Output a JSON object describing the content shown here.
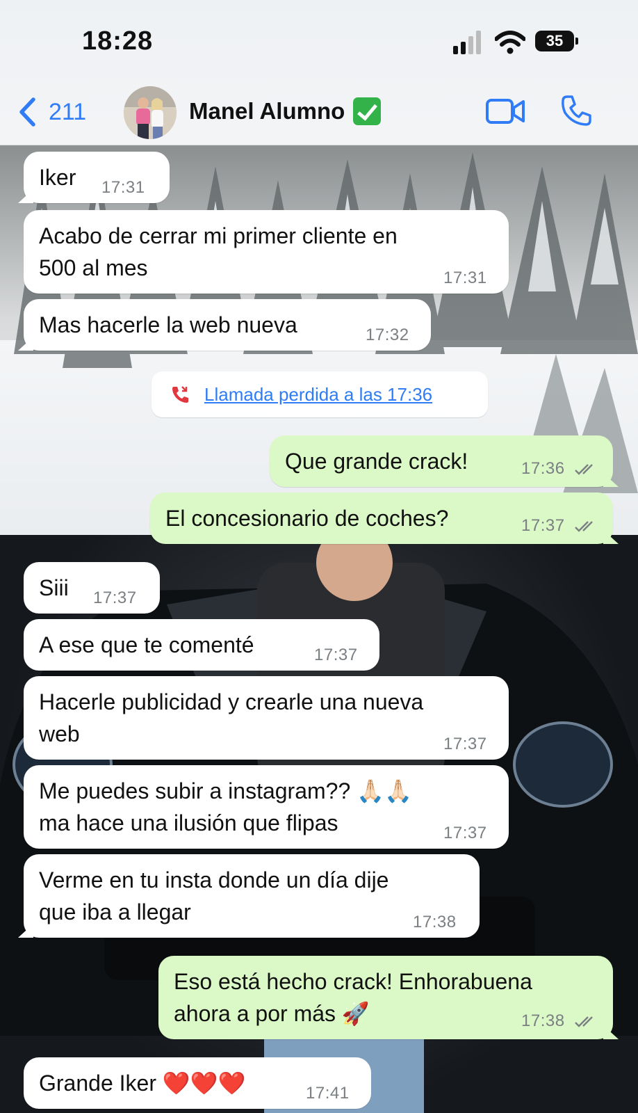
{
  "status_bar": {
    "time": "18:28",
    "battery": "35"
  },
  "header": {
    "back_count": "211",
    "contact_name": "Manel Alumno"
  },
  "messages": [
    {
      "text": "Iker",
      "time": "17:31"
    },
    {
      "text": "Acabo de cerrar mi primer cliente en\n500 al mes",
      "time": "17:31"
    },
    {
      "text": "Mas hacerle la web nueva",
      "time": "17:32"
    },
    {
      "text": "Llamada perdida a las 17:36"
    },
    {
      "text": "Que grande crack!",
      "time": "17:36"
    },
    {
      "text": "El concesionario de coches?",
      "time": "17:37"
    },
    {
      "text": "Siii",
      "time": "17:37"
    },
    {
      "text": "A ese que te comenté",
      "time": "17:37"
    },
    {
      "text": "Hacerle publicidad y crearle una nueva\nweb",
      "time": "17:37"
    },
    {
      "text": "Me puedes subir a instagram?? 🙏🏻🙏🏻\nma hace una ilusión que flipas",
      "time": "17:37"
    },
    {
      "text": "Verme en tu insta donde un día dije\nque iba a llegar",
      "time": "17:38"
    },
    {
      "text": "Eso está hecho crack! Enhorabuena\nahora a por más 🚀",
      "time": "17:38"
    },
    {
      "text": "Grande Iker ❤️❤️❤️",
      "time": "17:41"
    }
  ],
  "colors": {
    "accent": "#2f7cf6",
    "outgoing_bubble": "#dbf9c6",
    "incoming_bubble": "#ffffff",
    "missed_call": "#e0383e"
  }
}
